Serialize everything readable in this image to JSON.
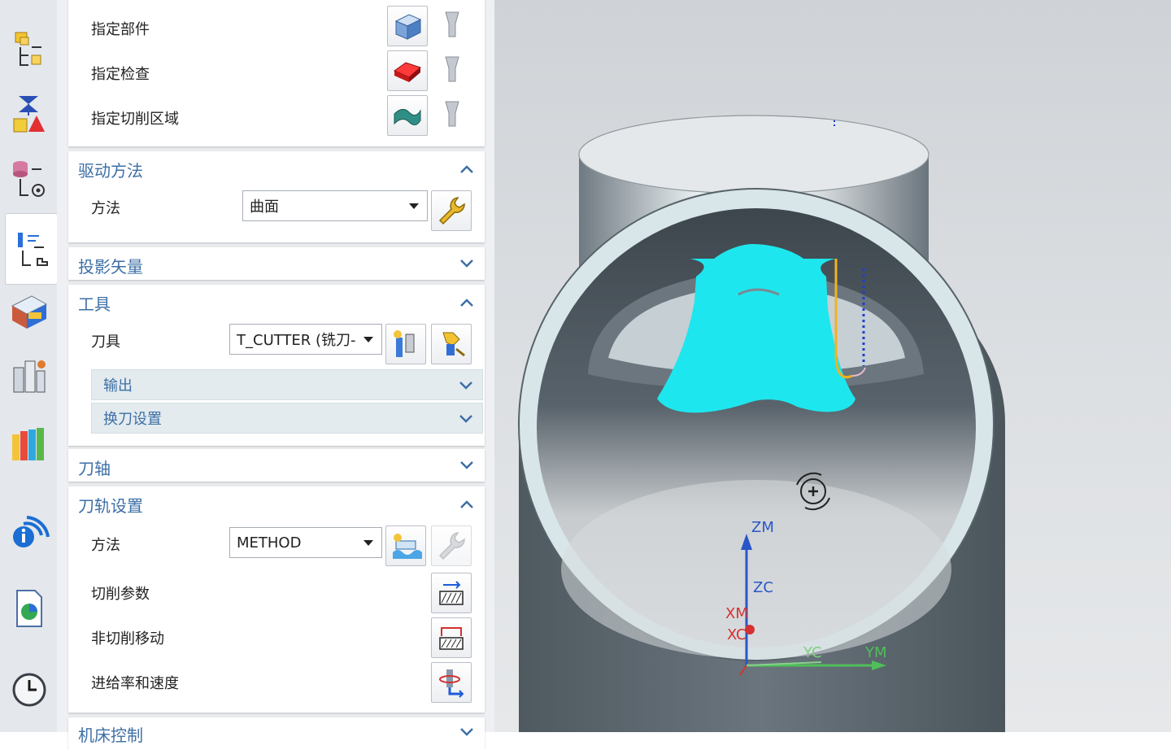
{
  "sidebar": {
    "items": [
      {
        "name": "operation-navigator-program-order-icon"
      },
      {
        "name": "machine-tool-view-icon"
      },
      {
        "name": "geometry-view-icon"
      },
      {
        "name": "machining-method-view-icon"
      },
      {
        "name": "tool-library-icon"
      },
      {
        "name": "operation-manager-icon"
      },
      {
        "name": "resource-library-icon"
      },
      {
        "name": "information-icon"
      },
      {
        "name": "web-page-icon"
      },
      {
        "name": "history-clock-icon"
      }
    ]
  },
  "geometry": {
    "rows": [
      {
        "label": "指定部件"
      },
      {
        "label": "指定检查"
      },
      {
        "label": "指定切削区域"
      }
    ]
  },
  "drive_method": {
    "title": "驱动方法",
    "method_label": "方法",
    "method_value": "曲面"
  },
  "projection_vector": {
    "title": "投影矢量"
  },
  "tool": {
    "title": "工具",
    "tool_label": "刀具",
    "tool_value": "T_CUTTER (铣刀-",
    "output_label": "输出",
    "tool_change_label": "换刀设置"
  },
  "tool_axis": {
    "title": "刀轴"
  },
  "path_settings": {
    "title": "刀轨设置",
    "method_label": "方法",
    "method_value": "METHOD",
    "cut_params": "切削参数",
    "non_cut_moves": "非切削移动",
    "feeds_speeds": "进给率和速度"
  },
  "next_group": {
    "title": "机床控制"
  },
  "viewport": {
    "axes": {
      "zm": "ZM",
      "zc": "ZC",
      "xm": "XM",
      "xc": "XC",
      "yc": "YC",
      "ym": "YM"
    },
    "colors": {
      "pipe": "#5f6a72",
      "pipe_rim": "#dce8ec",
      "toolpath_region": "#22e6ee",
      "axis_blue": "#2a56c8",
      "axis_green": "#4fbf5a",
      "axis_red": "#d63030"
    }
  }
}
